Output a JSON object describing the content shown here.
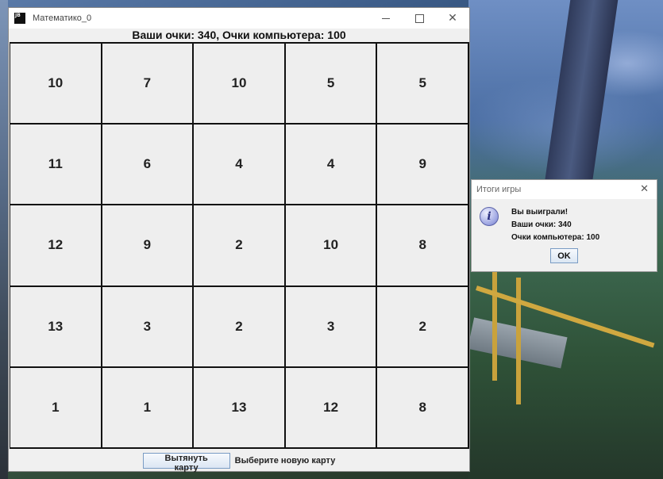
{
  "window": {
    "title": "Математико_0",
    "icon_text": "JB"
  },
  "score": {
    "text": "Ваши очки: 340, Очки компьютера: 100"
  },
  "grid": {
    "rows": [
      [
        "10",
        "7",
        "10",
        "5",
        "5"
      ],
      [
        "11",
        "6",
        "4",
        "4",
        "9"
      ],
      [
        "12",
        "9",
        "2",
        "10",
        "8"
      ],
      [
        "13",
        "3",
        "2",
        "3",
        "2"
      ],
      [
        "1",
        "1",
        "13",
        "12",
        "8"
      ]
    ]
  },
  "bottom": {
    "draw_button": "Вытянуть карту",
    "hint": "Выберите новую карту"
  },
  "dialog": {
    "title": "Итоги игры",
    "line1": "Вы выиграли!",
    "line2": "Ваши очки: 340",
    "line3": "Очки компьютера: 100",
    "ok": "OK"
  },
  "icons": {
    "app": "java-app-icon",
    "minimize": "minimize-icon",
    "maximize": "maximize-icon",
    "close": "close-icon",
    "info": "info-icon"
  }
}
